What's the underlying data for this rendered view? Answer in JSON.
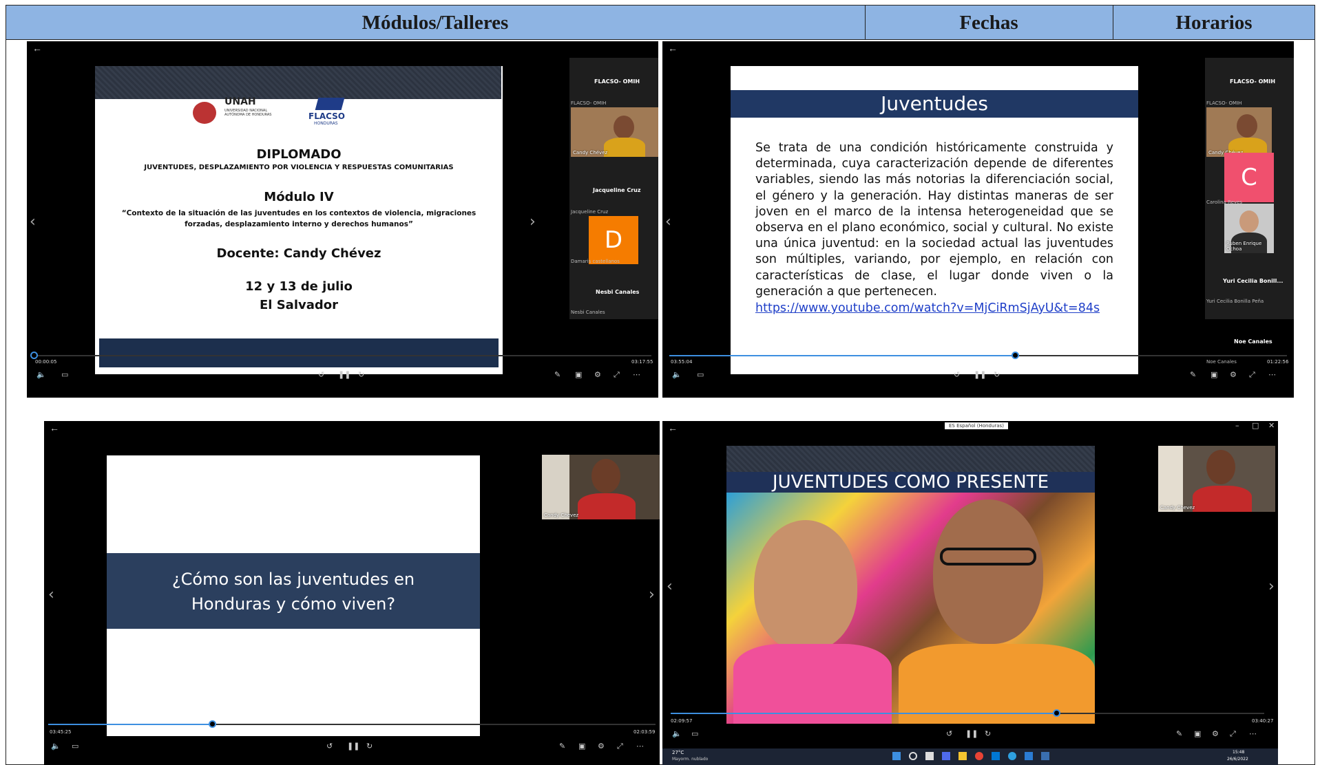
{
  "table": {
    "header": {
      "col1": "Módulos/Talleres",
      "col2": "Fechas",
      "col3": "Horarios"
    }
  },
  "player1": {
    "slide": {
      "logo_left": "UNAH",
      "logo_left_sub": "UNIVERSIDAD NACIONAL AUTÓNOMA DE HONDURAS",
      "logo_right": "FLACSO",
      "logo_right_sub": "HONDURAS",
      "title": "DIPLOMADO",
      "subtitle": "JUVENTUDES, DESPLAZAMIENTO POR VIOLENCIA Y RESPUESTAS COMUNITARIAS",
      "module": "Módulo IV",
      "quote": "“Contexto de la situación de las juventudes en los contextos de violencia, migraciones forzadas, desplazamiento interno y derechos humanos”",
      "teacher": "Docente: Candy Chévez",
      "date": "12 y 13 de julio",
      "country": "El Salvador"
    },
    "participants": {
      "top_name": "FLACSO- OMIH",
      "top_sub": "FLACSO- OMIH",
      "video1_label": "Candy Chévez",
      "p2_name": "Jacqueline Cruz",
      "p2_sub": "Jacqueline Cruz",
      "avatar_letter": "D",
      "avatar_color": "#f57c00",
      "avatar_label": "Damaris castellanos",
      "p4_name": "Nesbi Canales",
      "p4_sub": "Nesbi Canales"
    },
    "time_current": "00:00:05",
    "time_total": "03:17:55",
    "progress": 0.0
  },
  "player2": {
    "slide": {
      "title": "Juventudes",
      "body": "Se trata de una condición históricamente construida y determinada, cuya caracterización depende de diferentes variables, siendo las más notorias la diferenciación social, el género y la generación. Hay distintas maneras de ser joven en el marco de la intensa heterogeneidad que se observa en el plano económico, social y cultural. No existe una única juventud: en la sociedad actual las juventudes son múltiples, variando, por ejemplo, en relación con características de clase, el lugar donde viven o la generación a que pertenecen.",
      "link": "https://www.youtube.com/watch?v=MjCiRmSjAyU&t=84s"
    },
    "participants": {
      "top_name": "FLACSO- OMIH",
      "top_sub": "FLACSO- OMIH",
      "video1_label": "Candy Chévez",
      "avatar_letter": "C",
      "avatar_color": "#f0506e",
      "avatar_label": "Carolina Reyes",
      "video2_label": "Ruben Enrique Ochoa",
      "p4_name": "Yuri Cecilia Bonill...",
      "p4_sub": "Yuri Cecilia Bonilla Peña",
      "p5_name": "Noe Canales",
      "p5_sub": "Noe Canales"
    },
    "time_current": "03:55:04",
    "time_total": "01:22:56",
    "progress": 0.56
  },
  "player3": {
    "slide": {
      "question": "¿Cómo son las juventudes en Honduras y cómo viven?"
    },
    "video_label": "Candy Chevez",
    "time_current": "03:45:25",
    "time_total": "02:03:59",
    "progress": 0.27
  },
  "player4": {
    "slide": {
      "title": "JUVENTUDES COMO PRESENTE"
    },
    "video_label": "Candy Chevez",
    "language": "ES Español (Honduras)",
    "time_current": "02:09:57",
    "time_total": "03:40:27",
    "progress": 0.65,
    "taskbar": {
      "weather": "27°C",
      "weather_sub": "Mayorm. nublado",
      "clock": "15:48",
      "date": "26/6/2022"
    }
  },
  "icons": {
    "volume": "volume-icon",
    "captions": "captions-icon",
    "rewind": "rewind-icon",
    "pause": "pause-icon",
    "forward": "forward-icon",
    "pen": "pen-icon",
    "miniplayer": "miniplayer-icon",
    "settings": "settings-icon",
    "expand": "expand-icon",
    "more": "more-icon"
  }
}
